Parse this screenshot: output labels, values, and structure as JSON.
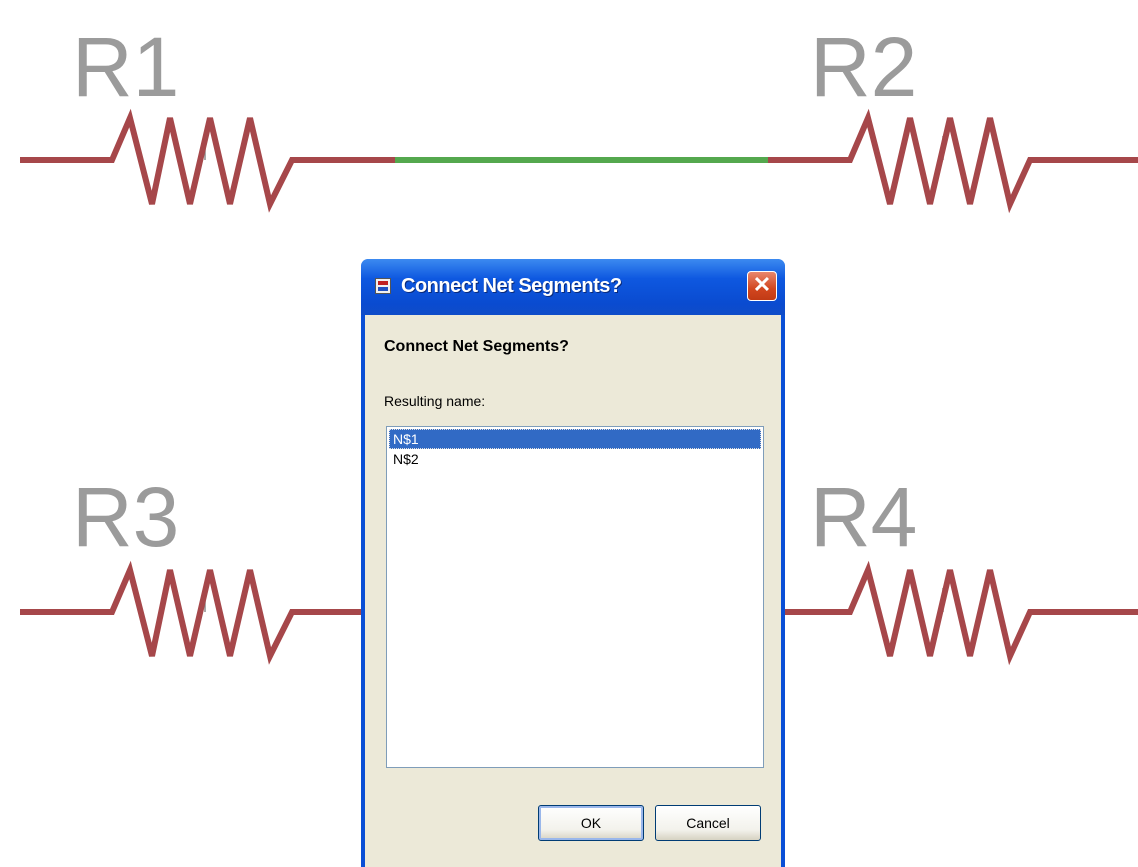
{
  "schematic": {
    "components": [
      {
        "ref": "R1"
      },
      {
        "ref": "R2"
      },
      {
        "ref": "R3"
      },
      {
        "ref": "R4"
      }
    ],
    "colors": {
      "wire": "#a6474a",
      "net_highlight": "#54a84e",
      "label": "#9b9b9b"
    }
  },
  "dialog": {
    "title": "Connect Net Segments?",
    "close_symbol": "✕",
    "heading": "Connect Net Segments?",
    "list_caption": "Resulting name:",
    "net_names": [
      "N$1",
      "N$2"
    ],
    "selected_index": 0,
    "ok_label": "OK",
    "cancel_label": "Cancel"
  }
}
